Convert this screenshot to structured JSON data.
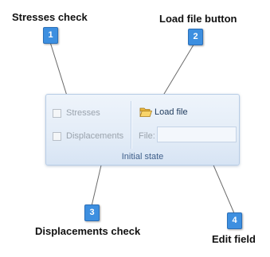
{
  "callouts": [
    {
      "number": "1",
      "title": "Stresses check"
    },
    {
      "number": "2",
      "title": "Load file button"
    },
    {
      "number": "3",
      "title": "Displacements check"
    },
    {
      "number": "4",
      "title": "Edit field"
    }
  ],
  "panel": {
    "stresses_label": "Stresses",
    "displacements_label": "Displacements",
    "load_file_label": "Load file",
    "file_label": "File:",
    "file_value": "",
    "group_label": "Initial state",
    "stresses_checked": false,
    "displacements_checked": false
  },
  "colors": {
    "badge": "#3d8fe0",
    "ribbon_bg": "#e3ecf7",
    "group_label": "#3e5f8a"
  }
}
